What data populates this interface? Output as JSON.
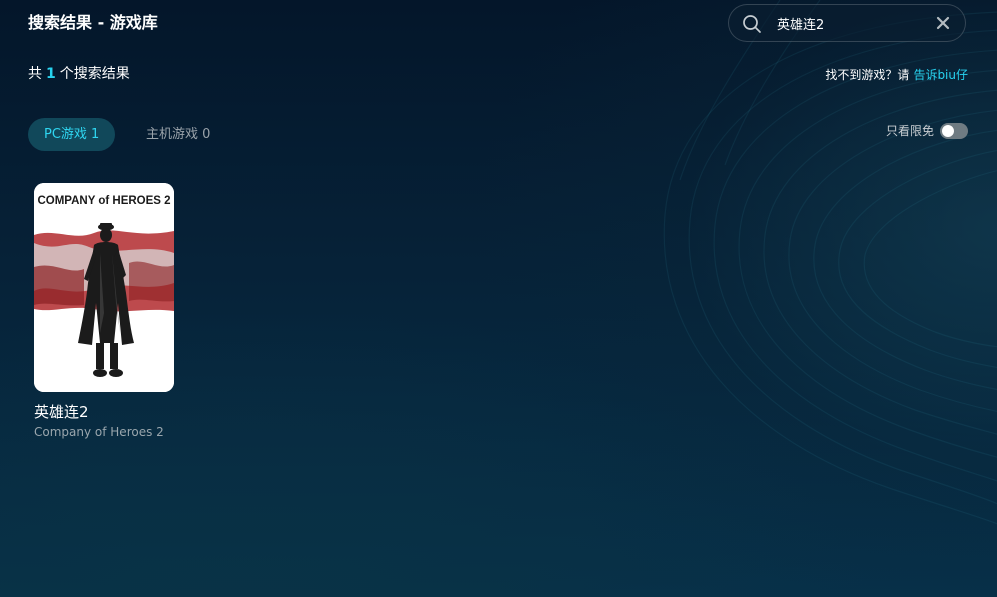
{
  "header": {
    "title": "搜索结果 - 游戏库"
  },
  "search": {
    "value": "英雄连2",
    "search_icon": "search-icon",
    "clear_icon": "close-icon"
  },
  "results": {
    "prefix": "共",
    "count": "1",
    "suffix": "个搜索结果"
  },
  "help": {
    "text": "找不到游戏？请",
    "link": "告诉biu仔"
  },
  "tabs": [
    {
      "label": "PC游戏 1",
      "active": true
    },
    {
      "label": "主机游戏 0",
      "active": false
    }
  ],
  "filter": {
    "free_label": "只看限免",
    "free_on": false
  },
  "games": [
    {
      "cover_title": "COMPANY of HEROES 2",
      "title": "英雄连2",
      "subtitle": "Company of Heroes 2"
    }
  ],
  "colors": {
    "accent": "#27d3f0",
    "tab_active_bg": "#11485a",
    "background": "#062238"
  }
}
